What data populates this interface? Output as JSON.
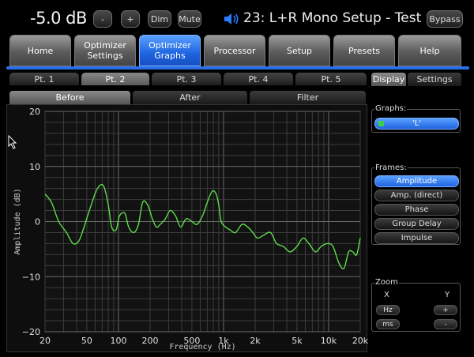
{
  "topbar": {
    "volume": "-5.0 dB",
    "minus": "-",
    "plus": "+",
    "dim": "Dim",
    "mute": "Mute",
    "title": "23: L+R Mono Setup - Test",
    "bypass": "Bypass"
  },
  "main_tabs": [
    {
      "label": "Home"
    },
    {
      "label": "Optimizer Settings"
    },
    {
      "label": "Optimizer Graphs"
    },
    {
      "label": "Processor"
    },
    {
      "label": "Setup"
    },
    {
      "label": "Presets"
    },
    {
      "label": "Help"
    }
  ],
  "point_tabs": [
    "Pt. 1",
    "Pt. 2",
    "Pt. 3",
    "Pt. 4",
    "Pt. 5"
  ],
  "view_tabs": [
    "Before",
    "After",
    "Filter"
  ],
  "side_tabs": [
    "Display",
    "Settings"
  ],
  "graphs": {
    "label": "Graphs:",
    "items": [
      "'L'"
    ]
  },
  "frames": {
    "label": "Frames:",
    "items": [
      "Amplitude",
      "Amp. (direct)",
      "Phase",
      "Group Delay",
      "Impulse"
    ]
  },
  "zoom": {
    "label": "Zoom",
    "x_label": "X",
    "y_label": "Y",
    "hz": "Hz",
    "ms": "ms",
    "plus": "+",
    "minus": "-"
  },
  "colors": {
    "accent": "#1e64e0",
    "trace": "#5ddc4a",
    "grid": "#5a5a5a"
  },
  "chart_data": {
    "type": "line",
    "title": "",
    "xlabel": "Frequency (Hz)",
    "ylabel": "Amplitude (dB)",
    "x_scale": "log",
    "xlim": [
      20,
      20000
    ],
    "ylim": [
      -20,
      20
    ],
    "x_ticks": [
      20,
      50,
      100,
      200,
      500,
      1000,
      2000,
      5000,
      10000,
      20000
    ],
    "x_tick_labels": [
      "20",
      "50",
      "100",
      "200",
      "500",
      "1k",
      "2k",
      "5k",
      "10k",
      "20k"
    ],
    "y_ticks": [
      -20,
      -10,
      0,
      10,
      20
    ],
    "y_tick_labels": [
      "−20",
      "−10",
      "0",
      "10",
      "20"
    ],
    "grid": true,
    "series": [
      {
        "x": [
          20,
          23,
          27,
          32,
          37,
          42,
          47,
          55,
          63,
          72,
          80,
          86,
          95,
          102,
          115,
          125,
          140,
          155,
          170,
          190,
          210,
          230,
          250,
          280,
          310,
          350,
          390,
          440,
          500,
          560,
          630,
          700,
          780,
          850,
          900,
          950,
          1050,
          1150,
          1300,
          1500,
          1700,
          1900,
          2100,
          2400,
          2800,
          3200,
          3700,
          4300,
          5000,
          5700,
          6500,
          7500,
          8500,
          9700,
          11000,
          12500,
          14000,
          15500,
          17000,
          18500,
          20000
        ],
        "y": [
          5,
          3.5,
          0,
          -2,
          -4,
          -3.5,
          -1,
          3,
          6,
          6.5,
          3,
          -1,
          -1.5,
          1,
          1.5,
          -1,
          -2,
          -0.5,
          3.5,
          3,
          0.5,
          -1,
          -0.5,
          0.5,
          2,
          1,
          -1,
          0.5,
          0,
          -0.5,
          1,
          3.5,
          5.5,
          5,
          3,
          0,
          -1,
          -1.5,
          -2,
          -0.5,
          -1,
          -2,
          -3,
          -2.5,
          -2,
          -4,
          -4.5,
          -5.5,
          -4.5,
          -3,
          -4,
          -5.5,
          -4.5,
          -4,
          -4.5,
          -7.5,
          -8.5,
          -5.5,
          -5.5,
          -6,
          -3
        ]
      }
    ]
  }
}
